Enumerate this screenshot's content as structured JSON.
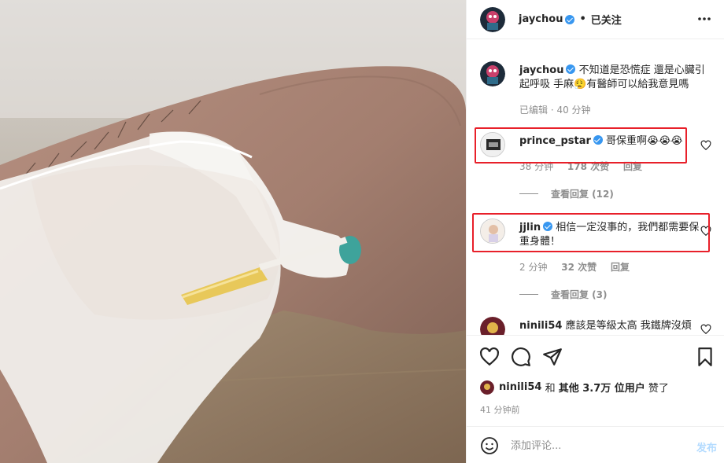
{
  "post": {
    "author": "jaychou",
    "follow_status": "已关注",
    "dot": "•",
    "caption": "不知道是恐慌症 還是心臟引起呼吸 手麻😮‍💨有醫師可以給我意見嗎",
    "caption_meta": "已编辑 · 40 分钟"
  },
  "comments": [
    {
      "username": "prince_pstar",
      "verified": true,
      "text": "哥保重啊😭😭😭",
      "time": "38 分钟",
      "likes": "178 次赞",
      "reply": "回复",
      "view_replies": "查看回复 (12)",
      "highlighted": true
    },
    {
      "username": "jjlin",
      "verified": true,
      "text": "相信一定沒事的，我們都需要保重身體！",
      "time": "2 分钟",
      "likes": "32 次赞",
      "reply": "回复",
      "view_replies": "查看回复 (3)",
      "highlighted": true
    },
    {
      "username": "ninili54",
      "verified": false,
      "text": "應該是等級太高 我鐵牌沒煩",
      "highlighted": false
    }
  ],
  "likes_line": {
    "user": "ninili54",
    "and": " 和 ",
    "others": "其他 3.7万 位用户",
    "suffix": " 赞了"
  },
  "posted_time": "41 分钟前",
  "add_comment": {
    "placeholder": "添加评论...",
    "post_label": "发布"
  },
  "icons": {
    "more": "more-horizontal-icon",
    "like": "heart-icon",
    "comment": "comment-bubble-icon",
    "share": "paper-plane-icon",
    "save": "bookmark-icon",
    "emoji": "emoji-smile-icon"
  },
  "colors": {
    "highlight": "#e8202a",
    "verified": "#3897f0",
    "post_button_disabled": "#b3dbff"
  }
}
